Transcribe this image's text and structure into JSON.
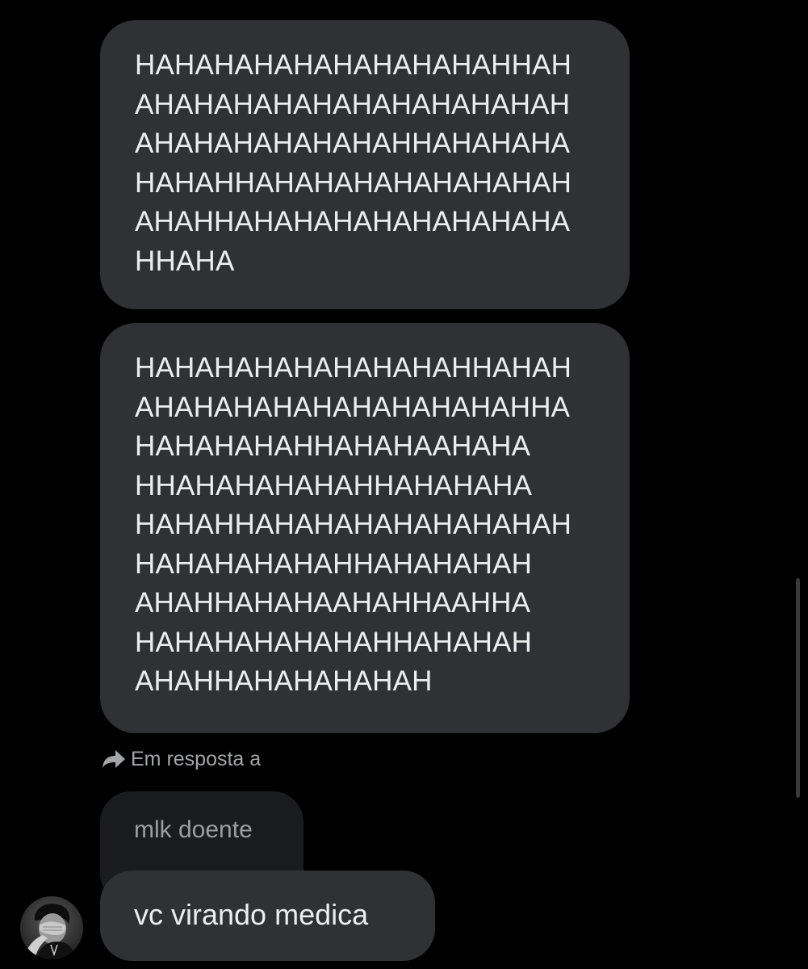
{
  "conversation": {
    "messages": [
      {
        "lines": [
          "HAHAHAHAHAHAHAHAHAHHAH",
          "AHAHAHAHAHAHAHAHAHAHAH",
          "AHAHAHAHAHAHAHHAHAHAHA",
          "HAHAHHAHAHAHAHAHAHAHAH",
          "AHAHHAHAHAHAHAHAHAHAHA",
          "HHAHA"
        ]
      },
      {
        "lines": [
          "HAHAHAHAHAHAHAHAHHAHAH",
          "AHAHAHAHAHAHAHAHAHAHHA",
          "HAHAHAHAHHAHAHAAHAHA",
          "HHAHAHAHAHAHHAHAHAHA",
          "HAHAHHAHAHAHAHAHAHAHAH",
          "HAHAHAHAHAHHAHAHAHAH",
          "AHAHHAHAHAAHAHHAAHHA",
          "HAHAHAHAHAHAHHAHAHAH",
          "AHAHHAHAHAHAHAH"
        ]
      }
    ],
    "reply": {
      "label": "Em resposta a",
      "icon": "reply-arrow-icon",
      "quoted_text": "mlk doente"
    },
    "last_message": {
      "text": "vc virando medica"
    },
    "sender": {
      "avatar": "avatar-photo"
    }
  },
  "colors": {
    "background": "#000000",
    "bubble": "#2f3133",
    "quoted_bubble": "#1a1b1c",
    "text": "#eceded",
    "muted_text": "#a3a5a7"
  }
}
